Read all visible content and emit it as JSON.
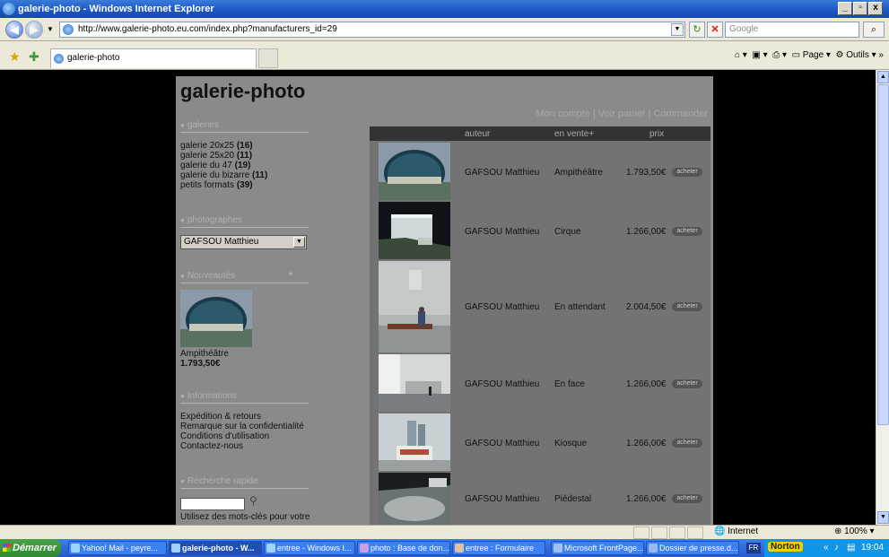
{
  "window": {
    "title": "galerie-photo - Windows Internet Explorer"
  },
  "browser": {
    "url": "http://www.galerie-photo.eu.com/index.php?manufacturers_id=29",
    "search_placeholder": "Google",
    "tab_label": "galerie-photo",
    "cmd_page": "Page",
    "cmd_tools": "Outils"
  },
  "site": {
    "logo": "galerie-photo",
    "top_links": "Mon compte | Voir panier | Commander",
    "sections": {
      "galleries": "galeries",
      "photographers": "photographes",
      "news": "Nouveautés",
      "info": "Informations",
      "search": "Recherche rapide"
    },
    "galleries": [
      {
        "name": "galerie 20x25",
        "count": "(16)"
      },
      {
        "name": "galerie 25x20",
        "count": "(11)"
      },
      {
        "name": "galerie du 47",
        "count": "(19)"
      },
      {
        "name": "galerie du bizarre",
        "count": "(11)"
      },
      {
        "name": "petits formats",
        "count": "(39)"
      }
    ],
    "selected_photographer": "GAFSOU Matthieu",
    "news_item": {
      "title": "Ampithéâtre",
      "price": "1.793,50€"
    },
    "info_links": [
      "Expédition & retours",
      "Remarque sur la confidentialité",
      "Conditions d'utilisation",
      "Contactez-nous"
    ],
    "search_hint": "Utilisez des mots-clés pour votre"
  },
  "products": {
    "headers": {
      "author": "auteur",
      "title": "en vente+",
      "price": "prix"
    },
    "buy_label": "acheter",
    "rows": [
      {
        "author": "GAFSOU Matthieu",
        "title": "Ampithéâtre",
        "price": "1.793,50€"
      },
      {
        "author": "GAFSOU Matthieu",
        "title": "Cirque",
        "price": "1.266,00€"
      },
      {
        "author": "GAFSOU Matthieu",
        "title": "En attendant",
        "price": "2.004,50€"
      },
      {
        "author": "GAFSOU Matthieu",
        "title": "En face",
        "price": "1.266,00€"
      },
      {
        "author": "GAFSOU Matthieu",
        "title": "Kiosque",
        "price": "1.266,00€"
      },
      {
        "author": "GAFSOU Matthieu",
        "title": "Piédestal",
        "price": "1.266,00€"
      }
    ]
  },
  "statusbar": {
    "zone": "Internet",
    "zoom": "100%"
  },
  "taskbar": {
    "start": "Démarrer",
    "tasks": [
      "Yahoo! Mail - peyre...",
      "galerie-photo - W...",
      "entree - Windows I...",
      "photo : Base de don...",
      "entree : Formulaire",
      "Microsoft FrontPage...",
      "Dossier de presse.d..."
    ],
    "lang": "FR",
    "norton": "Norton",
    "clock": "19:04"
  }
}
